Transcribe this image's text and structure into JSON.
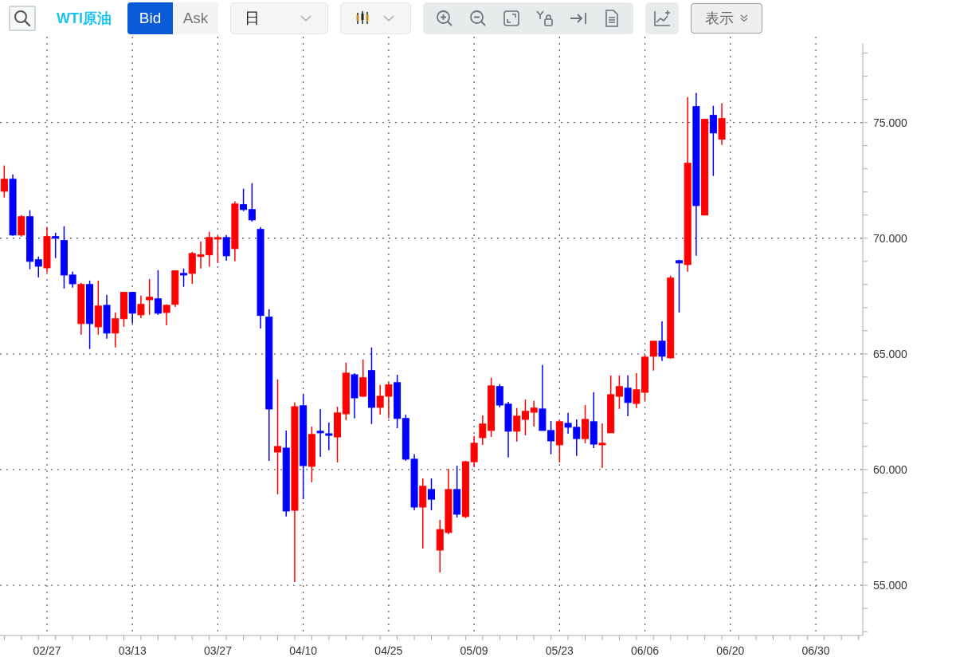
{
  "toolbar": {
    "symbol": "WTI原油",
    "price_side": [
      {
        "label": "Bid",
        "selected": true
      },
      {
        "label": "Ask",
        "selected": false
      }
    ],
    "period": {
      "value": "日"
    },
    "display_button": {
      "label": "表示"
    }
  },
  "chart": {
    "chart_data": {
      "type": "candlestick",
      "grid": true,
      "ylim": [
        52.9,
        78.4
      ],
      "categories": [
        null,
        null,
        null,
        null,
        null,
        "02/27",
        null,
        null,
        null,
        null,
        null,
        null,
        null,
        null,
        null,
        "03/13",
        null,
        null,
        null,
        null,
        null,
        null,
        null,
        null,
        null,
        "03/27",
        null,
        null,
        null,
        null,
        null,
        null,
        null,
        null,
        null,
        "04/10",
        null,
        null,
        null,
        null,
        null,
        null,
        null,
        null,
        null,
        "04/25",
        null,
        null,
        null,
        null,
        null,
        null,
        null,
        null,
        null,
        "05/09",
        null,
        null,
        null,
        null,
        null,
        null,
        null,
        null,
        null,
        "05/23",
        null,
        null,
        null,
        null,
        null,
        null,
        null,
        null,
        null,
        "06/06",
        null,
        null,
        null,
        null,
        null,
        null,
        null,
        null,
        null,
        "06/20",
        null,
        null,
        null,
        null,
        null,
        null,
        null,
        null,
        null,
        "06/30",
        null,
        null,
        null,
        null,
        null
      ],
      "yticks": [
        {
          "value": 55,
          "label": "55.000"
        },
        {
          "value": 60,
          "label": "60.000"
        },
        {
          "value": 65,
          "label": "65.000"
        },
        {
          "value": 70,
          "label": "70.000"
        },
        {
          "value": 75,
          "label": "75.000"
        }
      ],
      "ohlc": [
        [
          72.03,
          73.14,
          71.76,
          72.55
        ],
        [
          72.55,
          72.76,
          70.1,
          70.14
        ],
        [
          70.14,
          71.0,
          70.07,
          70.93
        ],
        [
          70.93,
          71.21,
          68.66,
          69.0
        ],
        [
          69.07,
          69.21,
          68.31,
          68.79
        ],
        [
          68.72,
          70.48,
          68.52,
          70.07
        ],
        [
          70.07,
          70.24,
          69.14,
          70.0
        ],
        [
          69.9,
          70.52,
          67.83,
          68.41
        ],
        [
          68.41,
          68.55,
          67.86,
          68.03
        ],
        [
          66.31,
          68.07,
          65.83,
          68.0
        ],
        [
          68.0,
          68.17,
          65.21,
          66.31
        ],
        [
          66.17,
          68.17,
          65.83,
          67.07
        ],
        [
          67.1,
          67.55,
          65.66,
          65.9
        ],
        [
          65.9,
          66.79,
          65.28,
          66.52
        ],
        [
          66.52,
          67.66,
          66.17,
          67.66
        ],
        [
          67.66,
          67.66,
          66.31,
          66.76
        ],
        [
          66.69,
          67.52,
          66.55,
          67.14
        ],
        [
          67.34,
          68.24,
          66.69,
          67.45
        ],
        [
          67.38,
          68.62,
          66.69,
          66.76
        ],
        [
          66.79,
          67.14,
          66.24,
          67.1
        ],
        [
          67.14,
          68.59,
          67.03,
          68.59
        ],
        [
          68.48,
          68.69,
          67.9,
          68.41
        ],
        [
          68.48,
          69.41,
          68.03,
          69.34
        ],
        [
          69.24,
          69.86,
          68.69,
          69.28
        ],
        [
          69.28,
          70.28,
          68.76,
          70.03
        ],
        [
          69.97,
          70.1,
          68.93,
          70.03
        ],
        [
          70.03,
          70.14,
          69.03,
          69.24
        ],
        [
          69.55,
          71.59,
          69.0,
          71.48
        ],
        [
          71.45,
          72.14,
          71.17,
          71.24
        ],
        [
          71.24,
          72.38,
          70.72,
          70.79
        ],
        [
          70.38,
          70.48,
          66.1,
          66.66
        ],
        [
          66.59,
          66.93,
          60.38,
          62.62
        ],
        [
          60.76,
          63.9,
          58.93,
          61.0
        ],
        [
          60.93,
          61.69,
          57.97,
          58.21
        ],
        [
          58.24,
          62.9,
          55.14,
          62.72
        ],
        [
          62.76,
          63.28,
          58.72,
          60.17
        ],
        [
          60.14,
          61.86,
          59.45,
          61.52
        ],
        [
          61.66,
          62.62,
          60.55,
          61.59
        ],
        [
          61.55,
          62.03,
          60.83,
          61.48
        ],
        [
          61.41,
          62.72,
          60.31,
          62.45
        ],
        [
          62.41,
          64.62,
          62.14,
          64.17
        ],
        [
          64.1,
          64.17,
          62.21,
          63.1
        ],
        [
          63.17,
          64.76,
          63.14,
          63.97
        ],
        [
          64.28,
          65.28,
          61.97,
          62.69
        ],
        [
          62.69,
          63.66,
          62.38,
          63.17
        ],
        [
          63.17,
          63.76,
          62.21,
          63.66
        ],
        [
          63.76,
          64.1,
          61.79,
          62.21
        ],
        [
          62.21,
          62.38,
          60.38,
          60.45
        ],
        [
          60.45,
          60.66,
          58.24,
          58.38
        ],
        [
          58.38,
          59.62,
          56.59,
          59.28
        ],
        [
          59.14,
          59.62,
          58.24,
          58.72
        ],
        [
          56.52,
          57.83,
          55.55,
          57.41
        ],
        [
          57.28,
          60.03,
          57.21,
          59.14
        ],
        [
          59.14,
          60.17,
          57.93,
          58.07
        ],
        [
          57.97,
          60.38,
          57.9,
          60.34
        ],
        [
          60.34,
          61.45,
          60.1,
          61.14
        ],
        [
          61.38,
          62.34,
          61.07,
          61.97
        ],
        [
          61.69,
          63.97,
          61.41,
          63.62
        ],
        [
          63.59,
          63.69,
          62.69,
          62.79
        ],
        [
          62.83,
          62.93,
          60.52,
          61.66
        ],
        [
          61.66,
          62.66,
          61.21,
          62.31
        ],
        [
          62.17,
          63.03,
          61.48,
          62.52
        ],
        [
          62.48,
          62.97,
          61.86,
          62.66
        ],
        [
          62.62,
          64.52,
          61.69,
          61.69
        ],
        [
          61.69,
          62.1,
          60.66,
          61.24
        ],
        [
          61.07,
          62.14,
          60.31,
          62.07
        ],
        [
          62.0,
          62.45,
          61.55,
          61.83
        ],
        [
          61.83,
          62.17,
          60.59,
          61.34
        ],
        [
          61.34,
          62.79,
          61.14,
          62.17
        ],
        [
          62.07,
          63.34,
          60.93,
          61.1
        ],
        [
          61.07,
          62.0,
          60.07,
          61.14
        ],
        [
          61.59,
          64.07,
          61.59,
          63.24
        ],
        [
          63.17,
          64.07,
          62.62,
          63.59
        ],
        [
          63.52,
          64.07,
          62.31,
          62.9
        ],
        [
          62.86,
          64.17,
          62.66,
          63.45
        ],
        [
          63.34,
          64.97,
          62.97,
          64.86
        ],
        [
          64.9,
          65.55,
          64.28,
          65.55
        ],
        [
          65.55,
          66.41,
          64.69,
          64.9
        ],
        [
          64.83,
          68.38,
          64.79,
          68.28
        ],
        [
          69.03,
          69.07,
          66.79,
          68.93
        ],
        [
          68.86,
          76.1,
          68.55,
          73.24
        ],
        [
          75.69,
          76.28,
          69.24,
          71.41
        ],
        [
          71.0,
          75.14,
          71.0,
          75.14
        ],
        [
          75.31,
          75.72,
          72.69,
          74.55
        ],
        [
          74.28,
          75.83,
          74.03,
          75.17
        ],
        null,
        null,
        null,
        null,
        null,
        null,
        null,
        null,
        null,
        null,
        null,
        null,
        null,
        null,
        null,
        null
      ]
    }
  }
}
